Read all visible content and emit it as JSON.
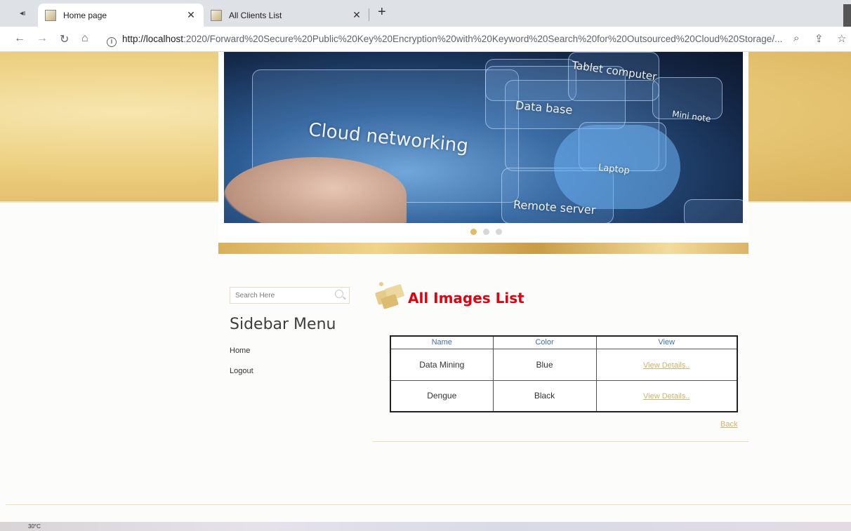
{
  "browser": {
    "tabs": [
      {
        "title": "Home page",
        "active": true
      },
      {
        "title": "All Clients List",
        "active": false
      }
    ],
    "url_host": "http://localhost",
    "url_path": ":2020/Forward%20Secure%20Public%20Key%20Encryption%20with%20Keyword%20Search%20for%20Outsourced%20Cloud%20Storage/...",
    "icons": {
      "mute": "speaker-muted-icon",
      "back": "arrow-left-icon",
      "forward": "arrow-right-icon",
      "reload": "reload-icon",
      "home": "home-icon",
      "info": "info-icon",
      "zoom": "magnifier-icon",
      "share": "share-icon",
      "bookmark": "star-icon",
      "close": "close-icon",
      "new_tab": "plus-icon"
    }
  },
  "banner": {
    "labels": {
      "cloud": "Cloud networking",
      "tablet": "Tablet computer",
      "database": "Data base",
      "mini": "Mini note",
      "laptop": "Laptop",
      "remote": "Remote server"
    },
    "slides": 3,
    "active_slide": 1
  },
  "sidebar": {
    "search_placeholder": "Search Here",
    "title": "Sidebar Menu",
    "links": [
      "Home",
      "Logout"
    ]
  },
  "main": {
    "title": "All Images List",
    "columns": [
      "Name",
      "Color",
      "View"
    ],
    "rows": [
      {
        "name": "Data Mining",
        "color": "Blue",
        "view": "View Details.."
      },
      {
        "name": "Dengue",
        "color": "Black",
        "view": "View Details.."
      }
    ],
    "back_label": "Back"
  },
  "taskbar": {
    "weather": "30°C"
  },
  "colors": {
    "accent_gold": "#d1b36b",
    "title_red": "#e3000f",
    "header_blue": "#3a6fb0"
  }
}
